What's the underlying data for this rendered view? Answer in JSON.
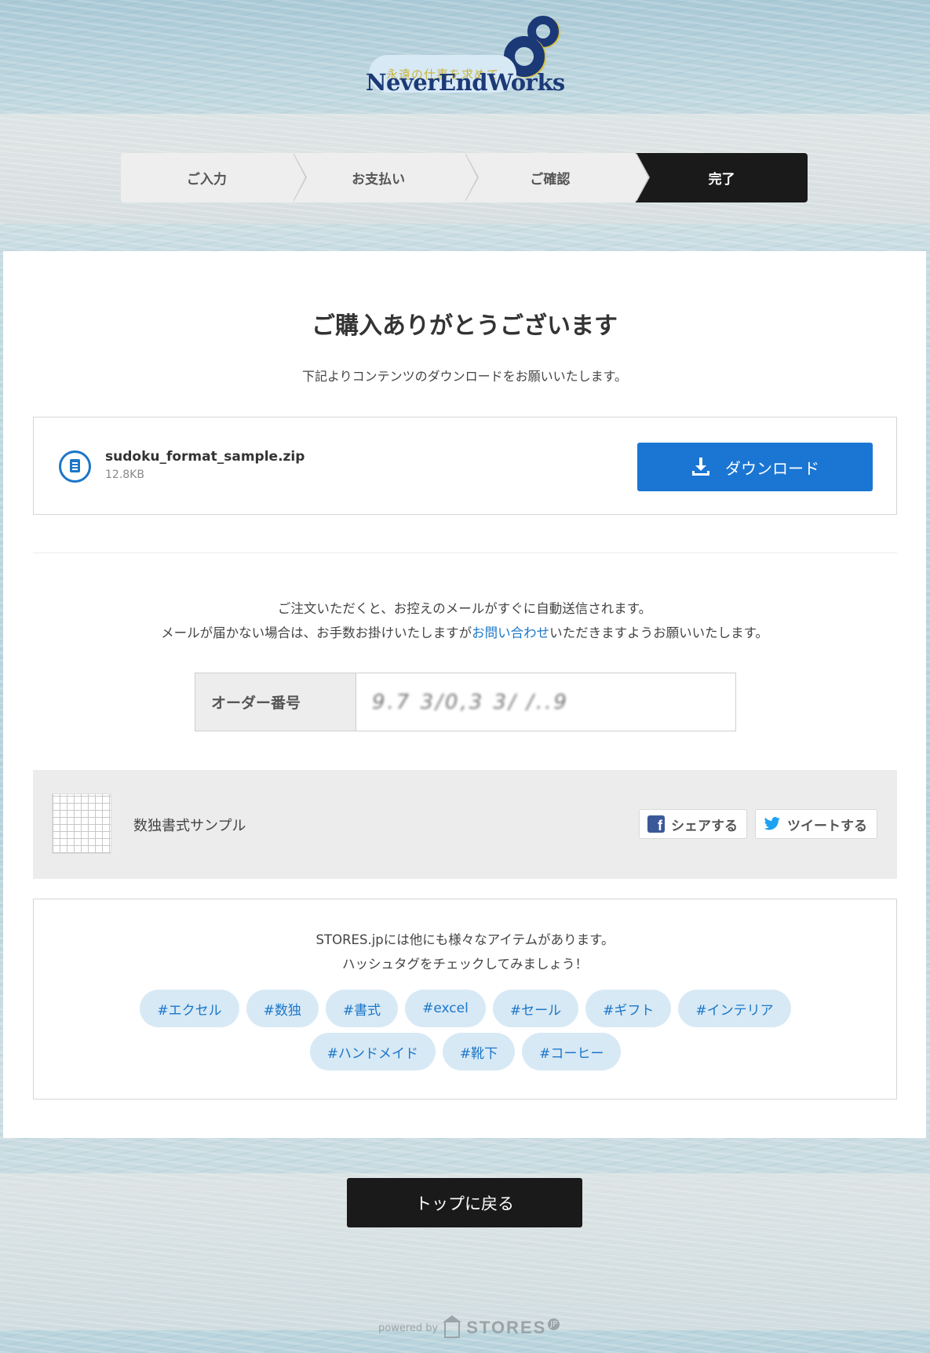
{
  "logo": {
    "tagline": "永遠の仕事を求めて",
    "brand": "NeverEndWorks"
  },
  "steps": [
    {
      "label": "ご入力"
    },
    {
      "label": "お支払い"
    },
    {
      "label": "ご確認"
    },
    {
      "label": "完了",
      "active": true
    }
  ],
  "main": {
    "title": "ご購入ありがとうございます",
    "subtitle": "下記よりコンテンツのダウンロードをお願いいたします。",
    "download": {
      "filename": "sudoku_format_sample.zip",
      "filesize": "12.8KB",
      "button_label": "ダウンロード",
      "icon": "download-icon"
    },
    "notice": {
      "line1": "ご注文いただくと、お控えのメールがすぐに自動送信されます。",
      "line2_before": "メールが届かない場合は、お手数お掛けいたしますが",
      "line2_link": "お問い合わせ",
      "line2_after": "いただきますようお願いいたします。"
    },
    "order": {
      "label": "オーダー番号",
      "value": "9.7 3/0,3 3/ /..9"
    },
    "product": {
      "name": "数独書式サンプル",
      "share_facebook": "シェアする",
      "share_twitter": "ツイートする"
    },
    "tags_section": {
      "line1": "STORES.jpには他にも様々なアイテムがあります。",
      "line2": "ハッシュタグをチェックしてみましょう！",
      "tags": [
        "#エクセル",
        "#数独",
        "#書式",
        "#excel",
        "#セール",
        "#ギフト",
        "#インテリア",
        "#ハンドメイド",
        "#靴下",
        "#コーヒー"
      ]
    }
  },
  "footer": {
    "back_button": "トップに戻る",
    "powered_by": "powered by",
    "stores_logo": "STORES",
    "jp_mark": "JP"
  },
  "colors": {
    "primary_blue": "#1b76d3",
    "dark": "#1a1a1a",
    "tag_bg": "#d7e9f5",
    "link": "#1b76c9"
  }
}
